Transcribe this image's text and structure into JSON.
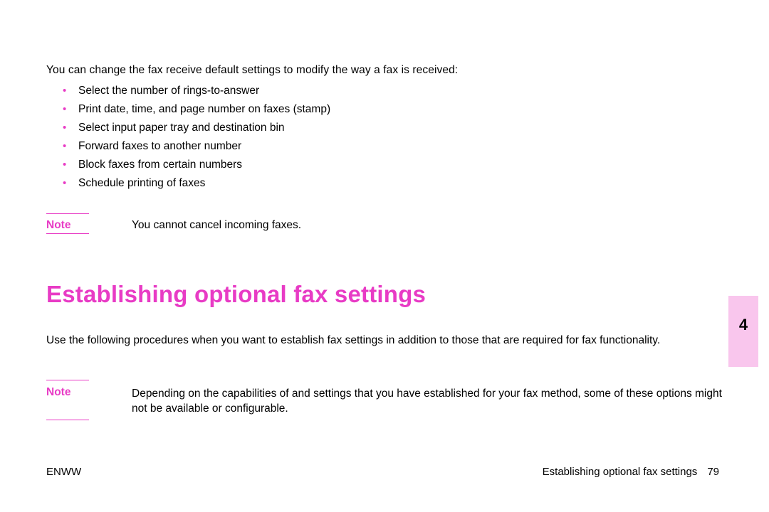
{
  "intro": "You can change the fax receive default settings to modify the way a fax is received:",
  "bullets": [
    "Select the number of rings-to-answer",
    "Print date, time, and page number on faxes (stamp)",
    "Select input paper tray and destination bin",
    "Forward faxes to another number",
    "Block faxes from certain numbers",
    "Schedule printing of faxes"
  ],
  "note1": {
    "label": "Note",
    "text": "You cannot cancel incoming faxes."
  },
  "heading": "Establishing optional fax settings",
  "body1": "Use the following procedures when you want to establish fax settings in addition to those that are required for fax functionality.",
  "note2": {
    "label": "Note",
    "text": "Depending on the capabilities of and settings that you have established for your fax method, some of these options might not be available or configurable."
  },
  "footer": {
    "left": "ENWW",
    "rightTitle": "Establishing optional fax settings",
    "pageNumber": "79"
  },
  "sideTab": "4"
}
